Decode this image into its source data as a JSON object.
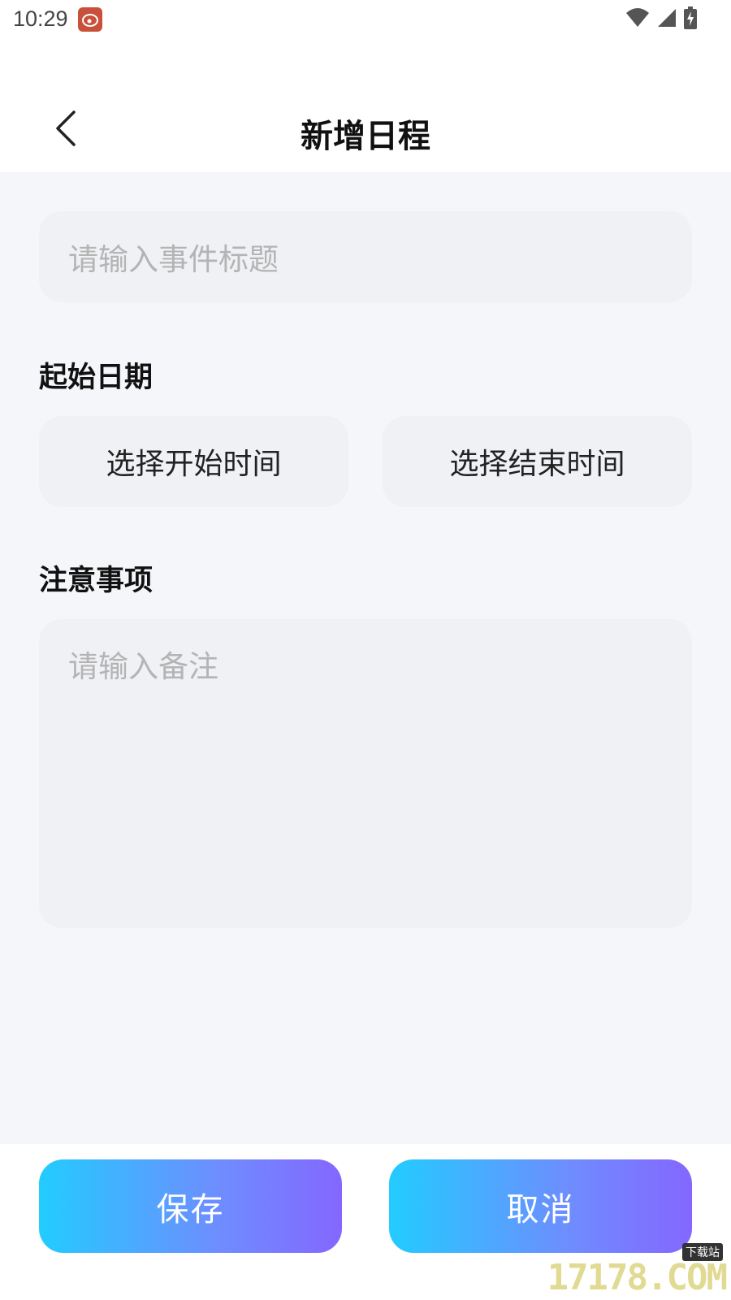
{
  "status_bar": {
    "time": "10:29",
    "app_icon": "weibo-app-icon",
    "icons": [
      "wifi-icon",
      "cellular-signal-icon",
      "battery-charging-icon"
    ]
  },
  "header": {
    "back_icon": "chevron-left-icon",
    "title": "新增日程"
  },
  "form": {
    "title_placeholder": "请输入事件标题",
    "date_section_label": "起始日期",
    "start_time_label": "选择开始时间",
    "end_time_label": "选择结束时间",
    "notes_section_label": "注意事项",
    "notes_placeholder": "请输入备注"
  },
  "footer": {
    "save_label": "保存",
    "cancel_label": "取消"
  },
  "colors": {
    "gradient_start": "#22ccff",
    "gradient_end": "#8467ff",
    "field_background": "#f0f1f5",
    "page_background": "#f5f6fa"
  }
}
